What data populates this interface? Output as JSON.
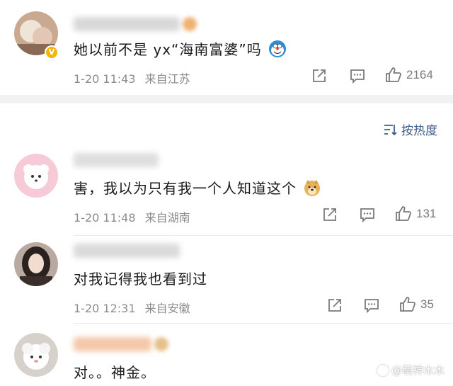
{
  "sort": {
    "label": "按热度",
    "icon": "sort-icon"
  },
  "comments": [
    {
      "text": "她以前不是 yx“海南富婆”吗",
      "emoji": "doraemon-emoji",
      "time": "1-20 11:43",
      "location": "来自江苏",
      "likes": "2164",
      "verified": true
    },
    {
      "text": "害，我以为只有我一个人知道这个",
      "emoji": "doge-emoji",
      "time": "1-20 11:48",
      "location": "来自湖南",
      "likes": "131"
    },
    {
      "text": "对我记得我也看到过",
      "time": "1-20 12:31",
      "location": "来自安徽",
      "likes": "35"
    },
    {
      "text": "对。。神金。"
    }
  ],
  "watermark": {
    "text": "@萌神木木"
  },
  "colors": {
    "link": "#3b5f8a",
    "meta": "#8c8c8c",
    "divider_band": "#f2f2f2",
    "verified": "#f2b705"
  }
}
